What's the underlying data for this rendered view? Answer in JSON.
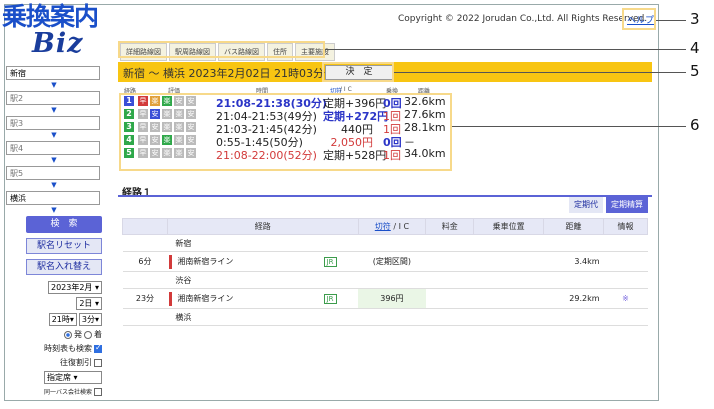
{
  "header": {
    "logo_top": "乗換案内",
    "logo_bottom": "Biz",
    "copyright": "Copyright © 2022 Jorudan Co.,Ltd. All Rights Reserved.",
    "help": "ヘルプ"
  },
  "sidebar": {
    "stations": [
      {
        "value": "新宿",
        "placeholder": ""
      },
      {
        "value": "",
        "placeholder": "駅2"
      },
      {
        "value": "",
        "placeholder": "駅3"
      },
      {
        "value": "",
        "placeholder": "駅4"
      },
      {
        "value": "",
        "placeholder": "駅5"
      },
      {
        "value": "横浜",
        "placeholder": ""
      }
    ],
    "search_btn": "検　索",
    "reset_btn": "駅名リセット",
    "swap_btn": "駅名入れ替え",
    "year_month": "2023年2月",
    "day": "2日",
    "hour": "21時",
    "minute": "3分",
    "depart": "発",
    "arrive": "着",
    "timetable": "時刻表も検索",
    "discount": "往復割引",
    "seat": "指定席",
    "bus": "同一バス会社検索"
  },
  "tabs": [
    "詳細路線図",
    "駅周路線図",
    "バス路線図",
    "住所",
    "主要施設"
  ],
  "route_bar": {
    "title": "新宿 ～ 横浜 2023年2月02日 21時03分発",
    "decide": "決　定"
  },
  "columns": {
    "route": "経路",
    "eval": "評価",
    "time": "時間",
    "fare_link": "切符",
    "fare_rest": " / I C",
    "transfer": "乗換",
    "distance": "距離"
  },
  "routes": [
    {
      "num": "1",
      "color": "#3a4fd6",
      "time": "21:08-21:38(30分)",
      "fare": "定期+396円",
      "transfer": "0回",
      "distance": "32.6km",
      "time_color": "#2b35c7",
      "bold": true
    },
    {
      "num": "2",
      "color": "#2fa84a",
      "time": "21:04-21:53(49分)",
      "fare": "定期+272円",
      "transfer": "1回",
      "distance": "27.6km",
      "time_color": "#222",
      "bold": false
    },
    {
      "num": "3",
      "color": "#2fa84a",
      "time": "21:03-21:45(42分)",
      "fare": "440円",
      "transfer": "1回",
      "distance": "28.1km",
      "time_color": "#222",
      "bold": false
    },
    {
      "num": "4",
      "color": "#2fa84a",
      "time": "0:55-1:45(50分)",
      "fare": "2,050円",
      "transfer": "0回",
      "distance": "－",
      "time_color": "#222",
      "bold": false
    },
    {
      "num": "5",
      "color": "#2fa84a",
      "time": "21:08-22:00(52分)",
      "fare": "定期+528円",
      "transfer": "1回",
      "distance": "34.0km",
      "time_color": "#d23a3a",
      "bold": false
    }
  ],
  "detail": {
    "title": "経路１",
    "teikidai": "定期代",
    "teiki_seisan": "定期精算",
    "headers": [
      "経路",
      "切符",
      " / I C",
      "料金",
      "乗車位置",
      "距離",
      "情報"
    ],
    "start": "新宿",
    "seg1": {
      "dur": "6分",
      "line": "湘南新宿ライン",
      "jr": "JR",
      "fare": "(定期区間)",
      "dist": "3.4km"
    },
    "mid": "渋谷",
    "seg2": {
      "dur": "23分",
      "line": "湘南新宿ライン",
      "jr": "JR",
      "fare": "396円",
      "dist": "29.2km",
      "info": "※"
    },
    "end": "横浜"
  },
  "annotations": [
    "3",
    "4",
    "5",
    "6"
  ]
}
